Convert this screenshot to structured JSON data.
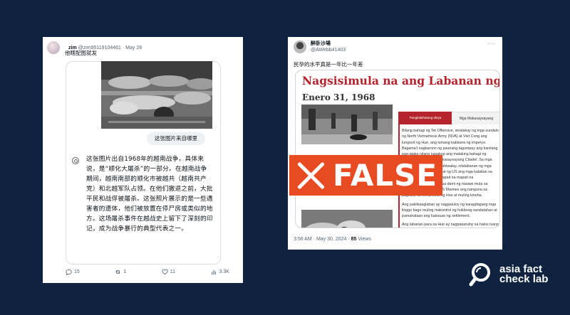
{
  "left_tweet": {
    "author_name": "zim",
    "handle": "@zim95119104461",
    "separator": "·",
    "date": "May 28",
    "text": "他瞎配图就发",
    "chat": {
      "user_question": "这张图片来自哪里",
      "answer": "这张图片出自1968年的越南战争，具体来说，是“顺化大屠杀”的一部分。在越南战争期间，越南南部的顺化市被越共（越南共产党）和北越军队占领。在他们撤退之前，大批平民和战俘被屠杀。这张照片展示的是一些遇害者的遗体，他们被放置在停尸房或类似的地方。这场屠杀事件在越战史上留下了深刻的印记，成为战争暴行的典型代表之一。"
    },
    "actions": {
      "replies": "15",
      "reposts": "1",
      "likes": "11",
      "views": "3.3K"
    }
  },
  "right_tweet": {
    "author_name": "醉卧沙場",
    "handle": "@AWebb41403",
    "text": "民孕的水平真是一年比一年差",
    "article": {
      "title": "Nagsisimula na ang Labanan ng Hue",
      "date": "Enero 31, 1968",
      "tabs": [
        "Pangkalahatang-ideya",
        "Mga Makasaysayang"
      ],
      "paragraphs": [
        "Bilang bahagi ng Tet Offensive, sinalakay ng mga sundalo ng North Vietnamese Army (NVA) at Viet Cong ang lungsod ng Hue, ang lumang kabisera ng imperyo. Bagama't nagkaroon ng paunang tagumpay ang kanilang pag-atake nilang nasakop ang malaking bahagi ng lungsod, pati na ang makasaysayang Citadel. Sa mga sumunod na linggo, nakahiwalay, nilalabanan ng mga tropa ng South Vietnam at ng US ang mga kalaban sa bawat kalye at bahay. Mapait na mapait na pakikipaglaban ito dahil sa dami ng nasawi mula sa militar at sibilyan. Ang US Marines ang nanguna sa pagbawi sa compound ng Hue at muling kinuha.",
        "Ang pakikipaglaban ay nagpatuloy ng karagdagang mga linggo bago muling makontrol ng hukbong-sandatahan at pamahalaan ang kabuuan ng settlement.",
        "Ang labanan para sa Hue ay nagpapatuloy sa halos isang buwan. Sinasabi na ang pinagsamang pagkamatay ng Viet Cong ang aabot sa 3,000 sibilyan, ha halos 10,000 bilang ng nasawi, nasugatan o nawala sa lahat ng panig. Sinira ng labanan ang lungsod, sinisira o sinasalanta ang humigit-kumulang 80 porsiyento ng mga istruktura nito. Mahigit 100,000 katao ang nawalan ng tirahan."
      ]
    },
    "overlay_label": "FALSE",
    "time": "3:56 AM",
    "date": "May 30, 2024",
    "views_count": "85",
    "views_label": "Views",
    "separator": "·"
  },
  "logo": {
    "line1": "asia fact",
    "line2": "check lab"
  },
  "colors": {
    "background": "#0f2340",
    "false_badge": "#e84a22",
    "article_title": "#b5242c"
  },
  "icons": {
    "reply": "reply-icon",
    "repost": "repost-icon",
    "like": "heart-icon",
    "views": "bar-chart-icon",
    "ai": "ai-assistant-icon",
    "more": "more-dots-icon"
  }
}
